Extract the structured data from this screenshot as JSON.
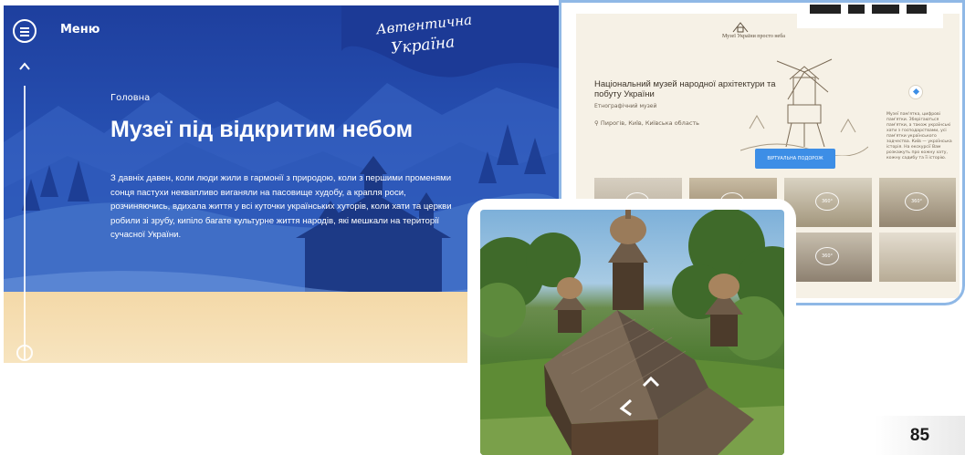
{
  "hero": {
    "menu_label": "Меню",
    "logo_line1": "Автентична",
    "logo_line2": "Україна",
    "breadcrumb": "Головна",
    "title": "Музеї під відкритим небом",
    "paragraph": "З давніх давен, коли люди жили в гармонії з природою, коли з першими променями сонця пастухи неквапливо виганяли на пасовище худобу, а крапля роси, розчиняючись, вдихала життя у всі куточки українських хуторів, коли хати та церкви робили зі зрубу, кипіло багате культурне життя народів, які мешкали на території сучасної України.",
    "colors": {
      "blue": "#2751b3",
      "sand": "#f4d9a8"
    }
  },
  "museum": {
    "brand": "Музеї України просто неба",
    "title": "Національний музей народної архітектури та побуту України",
    "subtitle": "Етнографічний музей",
    "location": "Пирогів, Київ, Київська область",
    "button_label": "ВІРТУАЛЬНА ПОДОРОЖ",
    "side_text": "Музеї пам'ятка, цифрові пам'ятки. Зберігаються пам'ятки, а також українські хати з господарствами, усі пам'ятки українського зодчества. Київ — українська історія. На екскурсії Вам розкажуть про кожну хату, кожну садибу та її історію.",
    "badge": "360°",
    "accent": "#3d8ee6"
  },
  "page_number": "85"
}
